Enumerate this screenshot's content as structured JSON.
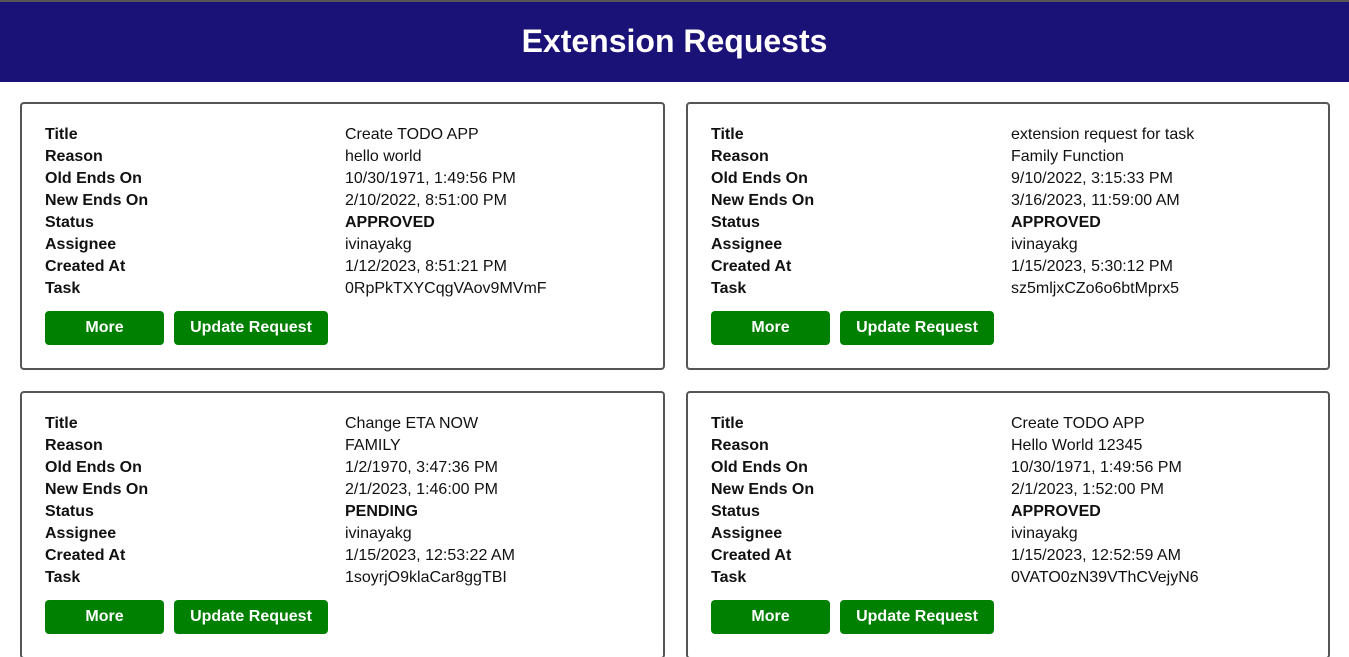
{
  "header": {
    "title": "Extension Requests"
  },
  "labels": {
    "title": "Title",
    "reason": "Reason",
    "old_ends_on": "Old Ends On",
    "new_ends_on": "New Ends On",
    "status": "Status",
    "assignee": "Assignee",
    "created_at": "Created At",
    "task": "Task"
  },
  "buttons": {
    "more": "More",
    "update": "Update Request"
  },
  "colors": {
    "header_bg": "#1b1278",
    "button_bg": "#008000"
  },
  "requests": [
    {
      "title": "Create TODO APP",
      "reason": "hello world",
      "old_ends_on": "10/30/1971, 1:49:56 PM",
      "new_ends_on": "2/10/2022, 8:51:00 PM",
      "status": "APPROVED",
      "assignee": "ivinayakg",
      "created_at": "1/12/2023, 8:51:21 PM",
      "task": "0RpPkTXYCqgVAov9MVmF"
    },
    {
      "title": "extension request for task",
      "reason": "Family Function",
      "old_ends_on": "9/10/2022, 3:15:33 PM",
      "new_ends_on": "3/16/2023, 11:59:00 AM",
      "status": "APPROVED",
      "assignee": "ivinayakg",
      "created_at": "1/15/2023, 5:30:12 PM",
      "task": "sz5mljxCZo6o6btMprx5"
    },
    {
      "title": "Change ETA NOW",
      "reason": "FAMILY",
      "old_ends_on": "1/2/1970, 3:47:36 PM",
      "new_ends_on": "2/1/2023, 1:46:00 PM",
      "status": "PENDING",
      "assignee": "ivinayakg",
      "created_at": "1/15/2023, 12:53:22 AM",
      "task": "1soyrjO9klaCar8ggTBI"
    },
    {
      "title": "Create TODO APP",
      "reason": "Hello World 12345",
      "old_ends_on": "10/30/1971, 1:49:56 PM",
      "new_ends_on": "2/1/2023, 1:52:00 PM",
      "status": "APPROVED",
      "assignee": "ivinayakg",
      "created_at": "1/15/2023, 12:52:59 AM",
      "task": "0VATO0zN39VThCVejyN6"
    }
  ]
}
